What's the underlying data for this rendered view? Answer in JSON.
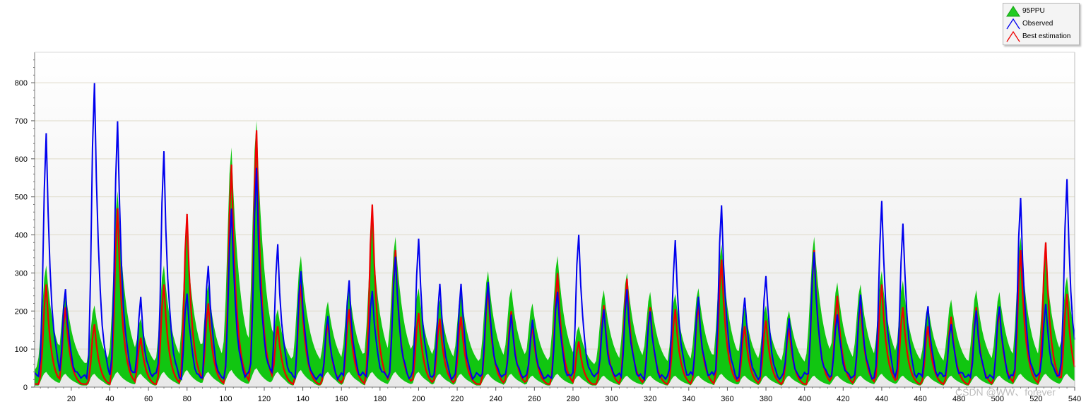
{
  "chart_data": {
    "type": "area",
    "ylim": [
      0,
      880
    ],
    "xlim": [
      1,
      540
    ],
    "x_ticks": [
      20,
      40,
      60,
      80,
      100,
      120,
      140,
      160,
      180,
      200,
      220,
      240,
      260,
      280,
      300,
      320,
      340,
      360,
      380,
      400,
      420,
      440,
      460,
      480,
      500,
      520,
      540
    ],
    "y_ticks": [
      0,
      100,
      200,
      300,
      400,
      500,
      600,
      700,
      800
    ],
    "grid": true,
    "legend_position": "top-right",
    "legend": [
      "95PPU",
      "Observed",
      "Best estimation"
    ],
    "colors": {
      "band": "#11c611",
      "observed": "#0000ee",
      "best": "#ee0000",
      "band_legend": "#22cc22"
    },
    "events": [
      {
        "t": 7,
        "obs": 675,
        "best": 270,
        "upper": 280,
        "lower": 40
      },
      {
        "t": 17,
        "obs": 265,
        "best": 210,
        "upper": 215,
        "lower": 35
      },
      {
        "t": 32,
        "obs": 800,
        "best": 165,
        "upper": 175,
        "lower": 35
      },
      {
        "t": 44,
        "obs": 700,
        "best": 470,
        "upper": 475,
        "lower": 40
      },
      {
        "t": 56,
        "obs": 235,
        "best": 130,
        "upper": 140,
        "lower": 35
      },
      {
        "t": 68,
        "obs": 620,
        "best": 270,
        "upper": 280,
        "lower": 40
      },
      {
        "t": 80,
        "obs": 250,
        "best": 455,
        "upper": 345,
        "lower": 45
      },
      {
        "t": 91,
        "obs": 320,
        "best": 220,
        "upper": 230,
        "lower": 40
      },
      {
        "t": 103,
        "obs": 470,
        "best": 585,
        "upper": 590,
        "lower": 45
      },
      {
        "t": 116,
        "obs": 575,
        "best": 675,
        "upper": 660,
        "lower": 50
      },
      {
        "t": 127,
        "obs": 375,
        "best": 160,
        "upper": 165,
        "lower": 40
      },
      {
        "t": 139,
        "obs": 310,
        "best": 270,
        "upper": 305,
        "lower": 45
      },
      {
        "t": 153,
        "obs": 180,
        "best": 170,
        "upper": 185,
        "lower": 40
      },
      {
        "t": 164,
        "obs": 275,
        "best": 205,
        "upper": 225,
        "lower": 40
      },
      {
        "t": 176,
        "obs": 260,
        "best": 480,
        "upper": 370,
        "lower": 40
      },
      {
        "t": 188,
        "obs": 350,
        "best": 360,
        "upper": 355,
        "lower": 40
      },
      {
        "t": 200,
        "obs": 385,
        "best": 195,
        "upper": 220,
        "lower": 40
      },
      {
        "t": 211,
        "obs": 265,
        "best": 180,
        "upper": 190,
        "lower": 35
      },
      {
        "t": 222,
        "obs": 265,
        "best": 185,
        "upper": 210,
        "lower": 35
      },
      {
        "t": 236,
        "obs": 285,
        "best": 260,
        "upper": 265,
        "lower": 35
      },
      {
        "t": 248,
        "obs": 190,
        "best": 200,
        "upper": 220,
        "lower": 35
      },
      {
        "t": 259,
        "obs": 175,
        "best": 160,
        "upper": 180,
        "lower": 30
      },
      {
        "t": 272,
        "obs": 250,
        "best": 300,
        "upper": 305,
        "lower": 35
      },
      {
        "t": 283,
        "obs": 400,
        "best": 120,
        "upper": 120,
        "lower": 30
      },
      {
        "t": 296,
        "obs": 205,
        "best": 215,
        "upper": 215,
        "lower": 30
      },
      {
        "t": 308,
        "obs": 255,
        "best": 285,
        "upper": 260,
        "lower": 30
      },
      {
        "t": 320,
        "obs": 200,
        "best": 210,
        "upper": 210,
        "lower": 30
      },
      {
        "t": 333,
        "obs": 380,
        "best": 205,
        "upper": 205,
        "lower": 30
      },
      {
        "t": 345,
        "obs": 235,
        "best": 215,
        "upper": 220,
        "lower": 30
      },
      {
        "t": 357,
        "obs": 485,
        "best": 335,
        "upper": 335,
        "lower": 35
      },
      {
        "t": 369,
        "obs": 240,
        "best": 160,
        "upper": 170,
        "lower": 30
      },
      {
        "t": 380,
        "obs": 295,
        "best": 175,
        "upper": 175,
        "lower": 30
      },
      {
        "t": 392,
        "obs": 175,
        "best": 155,
        "upper": 160,
        "lower": 30
      },
      {
        "t": 405,
        "obs": 360,
        "best": 360,
        "upper": 355,
        "lower": 30
      },
      {
        "t": 417,
        "obs": 200,
        "best": 240,
        "upper": 235,
        "lower": 30
      },
      {
        "t": 429,
        "obs": 240,
        "best": 220,
        "upper": 230,
        "lower": 30
      },
      {
        "t": 440,
        "obs": 485,
        "best": 270,
        "upper": 265,
        "lower": 35
      },
      {
        "t": 451,
        "obs": 425,
        "best": 210,
        "upper": 240,
        "lower": 30
      },
      {
        "t": 464,
        "obs": 215,
        "best": 160,
        "upper": 175,
        "lower": 30
      },
      {
        "t": 476,
        "obs": 175,
        "best": 185,
        "upper": 190,
        "lower": 30
      },
      {
        "t": 489,
        "obs": 195,
        "best": 210,
        "upper": 215,
        "lower": 30
      },
      {
        "t": 501,
        "obs": 210,
        "best": 205,
        "upper": 210,
        "lower": 30
      },
      {
        "t": 512,
        "obs": 495,
        "best": 360,
        "upper": 355,
        "lower": 35
      },
      {
        "t": 525,
        "obs": 220,
        "best": 380,
        "upper": 300,
        "lower": 35
      },
      {
        "t": 536,
        "obs": 550,
        "best": 245,
        "upper": 250,
        "lower": 35
      }
    ]
  },
  "watermark": "CSDN @WW、forever"
}
